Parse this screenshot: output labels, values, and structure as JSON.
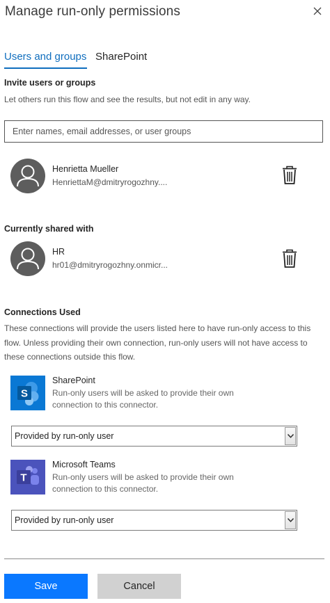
{
  "panel": {
    "title": "Manage run-only permissions"
  },
  "tabs": [
    {
      "label": "Users and groups",
      "active": true
    },
    {
      "label": "SharePoint",
      "active": false
    }
  ],
  "invite": {
    "heading": "Invite users or groups",
    "description": "Let others run this flow and see the results, but not edit in any way.",
    "placeholder": "Enter names, email addresses, or user groups"
  },
  "pending_users": [
    {
      "name": "Henrietta Mueller",
      "email": "HenriettaM@dmitryrogozhny...."
    }
  ],
  "shared": {
    "heading": "Currently shared with",
    "users": [
      {
        "name": "HR",
        "email": "hr01@dmitryrogozhny.onmicr..."
      }
    ]
  },
  "connections": {
    "heading": "Connections Used",
    "description": "These connections will provide the users listed here to have run-only access to this flow. Unless providing their own connection, run-only users will not have access to these connections outside this flow.",
    "items": [
      {
        "name": "SharePoint",
        "description": "Run-only users will be asked to provide their own connection to this connector.",
        "selected_option": "Provided by run-only user",
        "icon": "sharepoint-icon",
        "color": "#0a78d4"
      },
      {
        "name": "Microsoft Teams",
        "description": "Run-only users will be asked to provide their own connection to this connector.",
        "selected_option": "Provided by run-only user",
        "icon": "teams-icon",
        "color": "#4b53bc"
      }
    ]
  },
  "footer": {
    "save_label": "Save",
    "cancel_label": "Cancel"
  },
  "colors": {
    "accent": "#106ebe",
    "primary_button": "#0a78ff",
    "avatar": "#5d5d5d"
  }
}
